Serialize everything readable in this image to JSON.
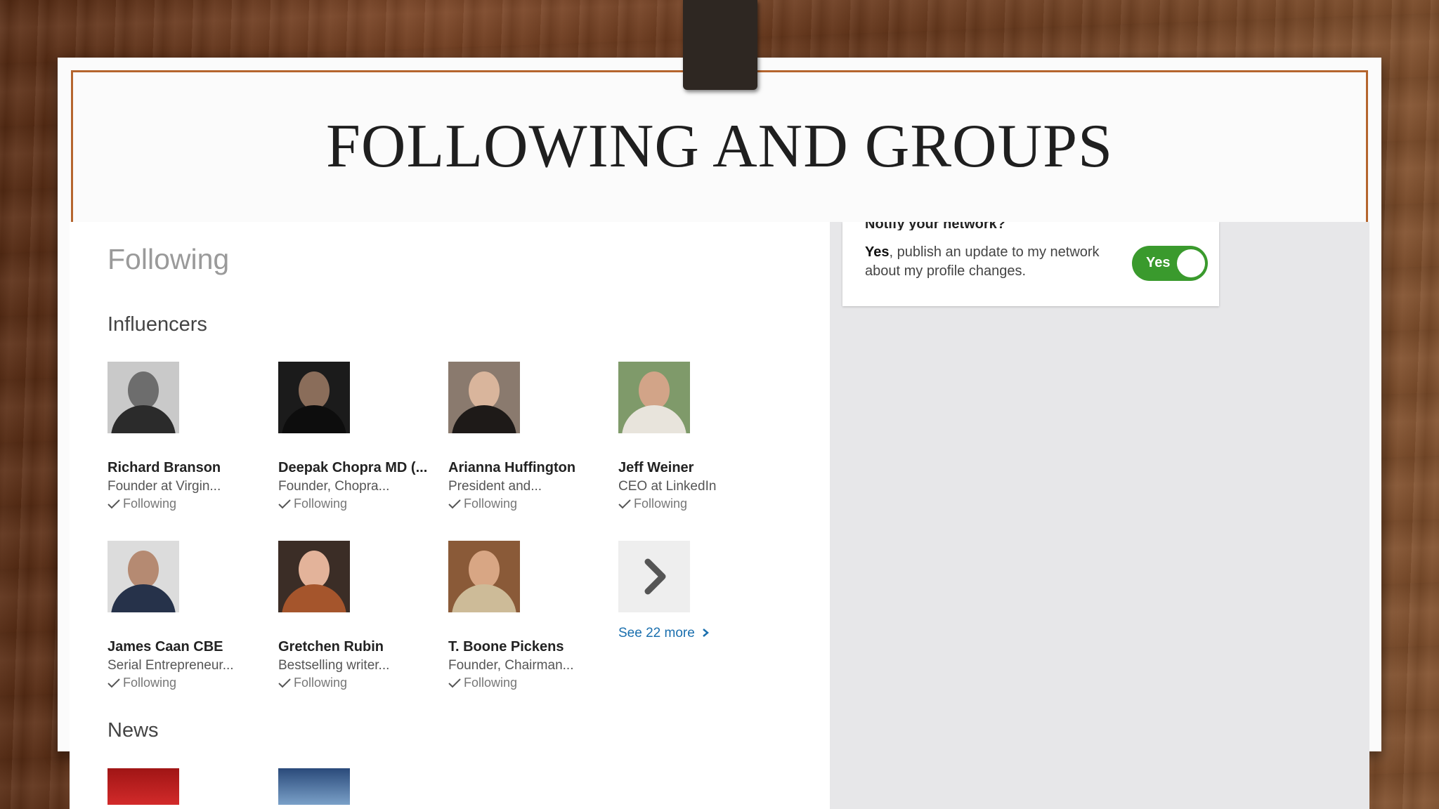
{
  "slide": {
    "title": "FOLLOWING AND GROUPS"
  },
  "page": {
    "heading": "Following"
  },
  "notify": {
    "heading": "Notify your network?",
    "text_bold": "Yes",
    "text_rest": ", publish an update to my network about my profile changes.",
    "toggle_label": "Yes"
  },
  "influencers": {
    "heading": "Influencers",
    "people": [
      {
        "name": "Richard Branson",
        "title": "Founder at Virgin...",
        "status": "Following"
      },
      {
        "name": "Deepak Chopra MD (...",
        "title": "Founder, Chopra...",
        "status": "Following"
      },
      {
        "name": "Arianna Huffington",
        "title": "President and...",
        "status": "Following"
      },
      {
        "name": "Jeff Weiner",
        "title": "CEO at LinkedIn",
        "status": "Following"
      },
      {
        "name": "James Caan CBE",
        "title": "Serial Entrepreneur...",
        "status": "Following"
      },
      {
        "name": "Gretchen Rubin",
        "title": "Bestselling writer...",
        "status": "Following"
      },
      {
        "name": "T. Boone Pickens",
        "title": "Founder, Chairman...",
        "status": "Following"
      }
    ],
    "see_more": "See 22 more"
  },
  "news": {
    "heading": "News"
  },
  "icons": {
    "next": "chevron-right-icon",
    "check": "checkmark-icon"
  },
  "colors": {
    "toggle_on": "#3a9a2d",
    "link": "#1a6fae",
    "frame": "#b5652e"
  }
}
